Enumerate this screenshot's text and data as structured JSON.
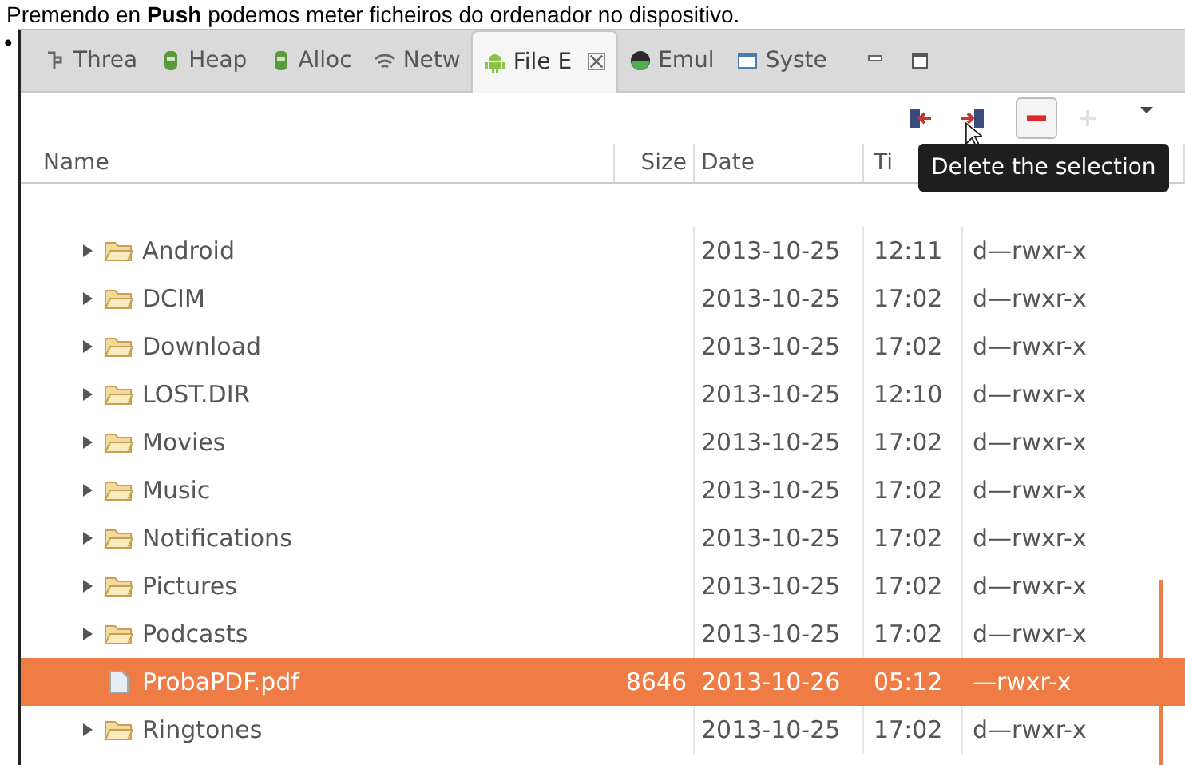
{
  "intro_text": "Premendo en **Push** podemos meter ficheiros do ordenador no dispositivo.",
  "bullet": "•",
  "tabs": [
    {
      "label": "Threa",
      "selected": false
    },
    {
      "label": "Heap",
      "selected": false
    },
    {
      "label": "Alloc",
      "selected": false
    },
    {
      "label": "Netw",
      "selected": false
    },
    {
      "label": "File E",
      "selected": true
    },
    {
      "label": "Emul",
      "selected": false
    },
    {
      "label": "Syste",
      "selected": false
    }
  ],
  "toolbar": [
    {
      "disabled": false
    },
    {
      "disabled": false
    },
    {
      "disabled": false
    },
    {
      "disabled": true
    }
  ],
  "tooltip": "Delete the selection",
  "columns": [
    "Name",
    "Size",
    "Date",
    "Ti"
  ],
  "rows": [
    {
      "kind": "folder",
      "name": "Android",
      "date": "2013-10-25",
      "time": "12:11",
      "permissions": "d—rwxr-x",
      "selected": false
    },
    {
      "kind": "folder",
      "name": "DCIM",
      "date": "2013-10-25",
      "time": "17:02",
      "permissions": "d—rwxr-x",
      "selected": false
    },
    {
      "kind": "folder",
      "name": "Download",
      "date": "2013-10-25",
      "time": "17:02",
      "permissions": "d—rwxr-x",
      "selected": false
    },
    {
      "kind": "folder",
      "name": "LOST.DIR",
      "date": "2013-10-25",
      "time": "12:10",
      "permissions": "d—rwxr-x",
      "selected": false
    },
    {
      "kind": "folder",
      "name": "Movies",
      "date": "2013-10-25",
      "time": "17:02",
      "permissions": "d—rwxr-x",
      "selected": false
    },
    {
      "kind": "folder",
      "name": "Music",
      "date": "2013-10-25",
      "time": "17:02",
      "permissions": "d—rwxr-x",
      "selected": false
    },
    {
      "kind": "folder",
      "name": "Notifications",
      "date": "2013-10-25",
      "time": "17:02",
      "permissions": "d—rwxr-x",
      "selected": false
    },
    {
      "kind": "folder",
      "name": "Pictures",
      "date": "2013-10-25",
      "time": "17:02",
      "permissions": "d—rwxr-x",
      "selected": false
    },
    {
      "kind": "folder",
      "name": "Podcasts",
      "date": "2013-10-25",
      "time": "17:02",
      "permissions": "d—rwxr-x",
      "selected": false
    },
    {
      "kind": "file",
      "name": "ProbaPDF.pdf",
      "size": "8646",
      "date": "2013-10-26",
      "time": "05:12",
      "permissions": "—rwxr-x",
      "selected": true
    },
    {
      "kind": "folder",
      "name": "Ringtones",
      "date": "2013-10-25",
      "time": "17:02",
      "permissions": "d—rwxr-x",
      "selected": false
    }
  ]
}
